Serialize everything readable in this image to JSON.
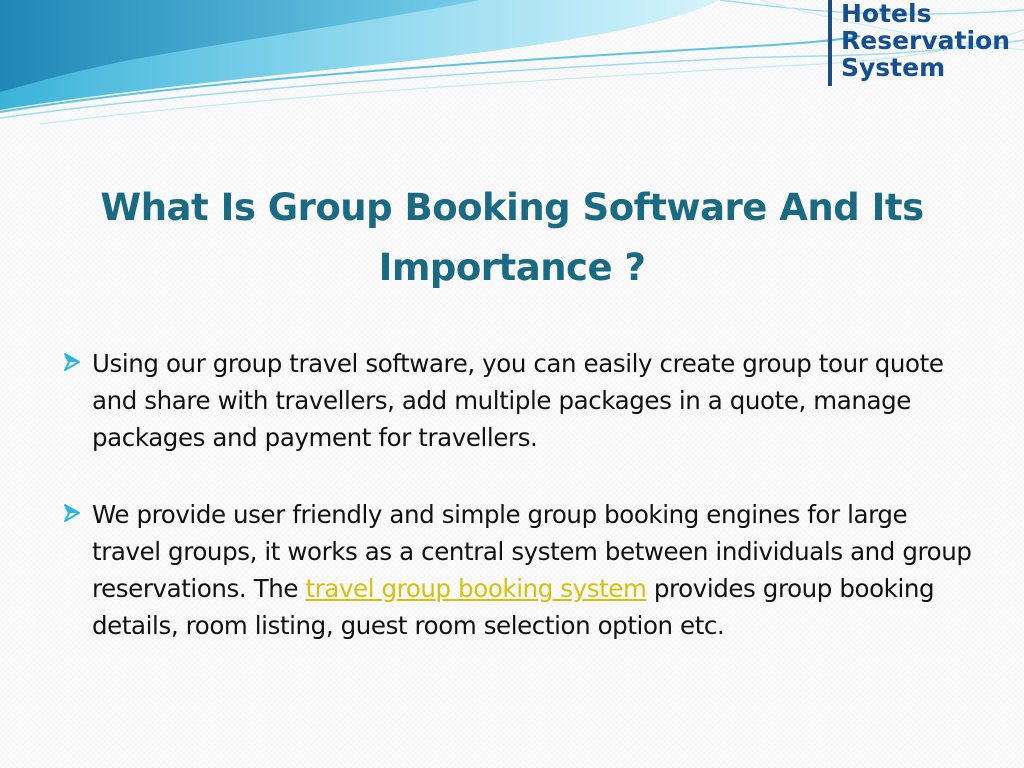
{
  "logo": {
    "line1": "Hotels",
    "line2": "Reservation",
    "line3": "System"
  },
  "title": {
    "line1": "What Is Group Booking Software And Its",
    "line2": "Importance ?"
  },
  "bullets": [
    {
      "text": "Using our group travel software, you can easily create group tour quote and share with travellers, add multiple packages in a quote, manage packages and payment for travellers."
    },
    {
      "text_before": "We provide user friendly and simple group booking engines for large travel groups, it works as a central system between individuals and group reservations. The ",
      "link_text": "travel group booking system",
      "text_after": " provides group booking details, room listing, guest room selection option etc."
    }
  ],
  "colors": {
    "title": "#1b6a84",
    "link": "#d8c10a",
    "logo": "#164e93",
    "bullet_icon": "#2bb6dc"
  },
  "icons": {
    "bullet": "arrow-bullet-icon"
  }
}
